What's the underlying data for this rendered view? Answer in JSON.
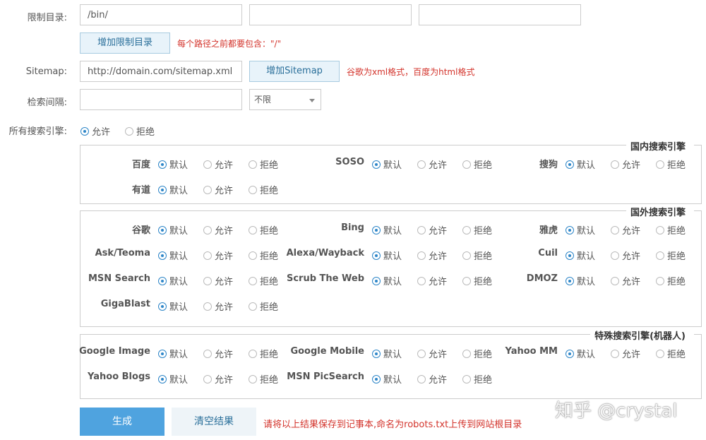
{
  "form": {
    "restrict_label": "限制目录:",
    "restrict_values": [
      "/bin/",
      "",
      ""
    ],
    "add_restrict_btn": "增加限制目录",
    "restrict_hint": "每个路径之前都要包含：\"/\"",
    "sitemap_label": "Sitemap:",
    "sitemap_value": "http://domain.com/sitemap.xml",
    "add_sitemap_btn": "增加Sitemap",
    "sitemap_hint": "谷歌为xml格式，百度为html格式",
    "interval_label": "检索间隔:",
    "interval_value": "",
    "interval_select": "不限",
    "all_engines_label": "所有搜索引擎:",
    "all_allow": "允许",
    "all_deny": "拒绝"
  },
  "options": {
    "default": "默认",
    "allow": "允许",
    "deny": "拒绝"
  },
  "groups": [
    {
      "title": "国内搜索引擎",
      "engines": [
        "百度",
        "SOSO",
        "搜狗",
        "有道"
      ]
    },
    {
      "title": "国外搜索引擎",
      "engines": [
        "谷歌",
        "Bing",
        "雅虎",
        "Ask/Teoma",
        "Alexa/Wayback",
        "Cuil",
        "MSN Search",
        "Scrub The Web",
        "DMOZ",
        "GigaBlast"
      ]
    },
    {
      "title": "特殊搜索引擎(机器人)",
      "engines": [
        "Google Image",
        "Google Mobile",
        "Yahoo MM",
        "Yahoo Blogs",
        "MSN PicSearch"
      ]
    }
  ],
  "actions": {
    "generate": "生成",
    "clear": "清空结果",
    "hint": "请将以上结果保存到记事本,命名为robots.txt上传到网站根目录"
  },
  "watermark": "知乎 @crystal",
  "colors": {
    "primary": "#4fa3df",
    "hint": "#d3332b",
    "radio": "#2e86c8"
  }
}
